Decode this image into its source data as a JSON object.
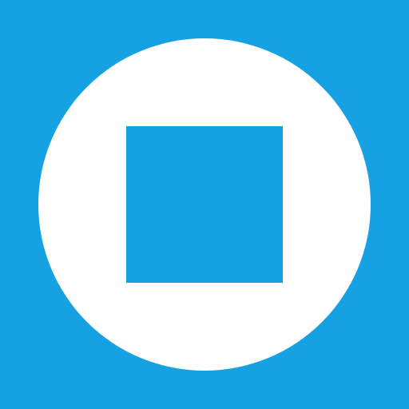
{
  "icon": {
    "name": "stop-icon",
    "background_color": "#16A2E2",
    "circle_color": "#FFFFFF",
    "square_color": "#16A2E2"
  }
}
